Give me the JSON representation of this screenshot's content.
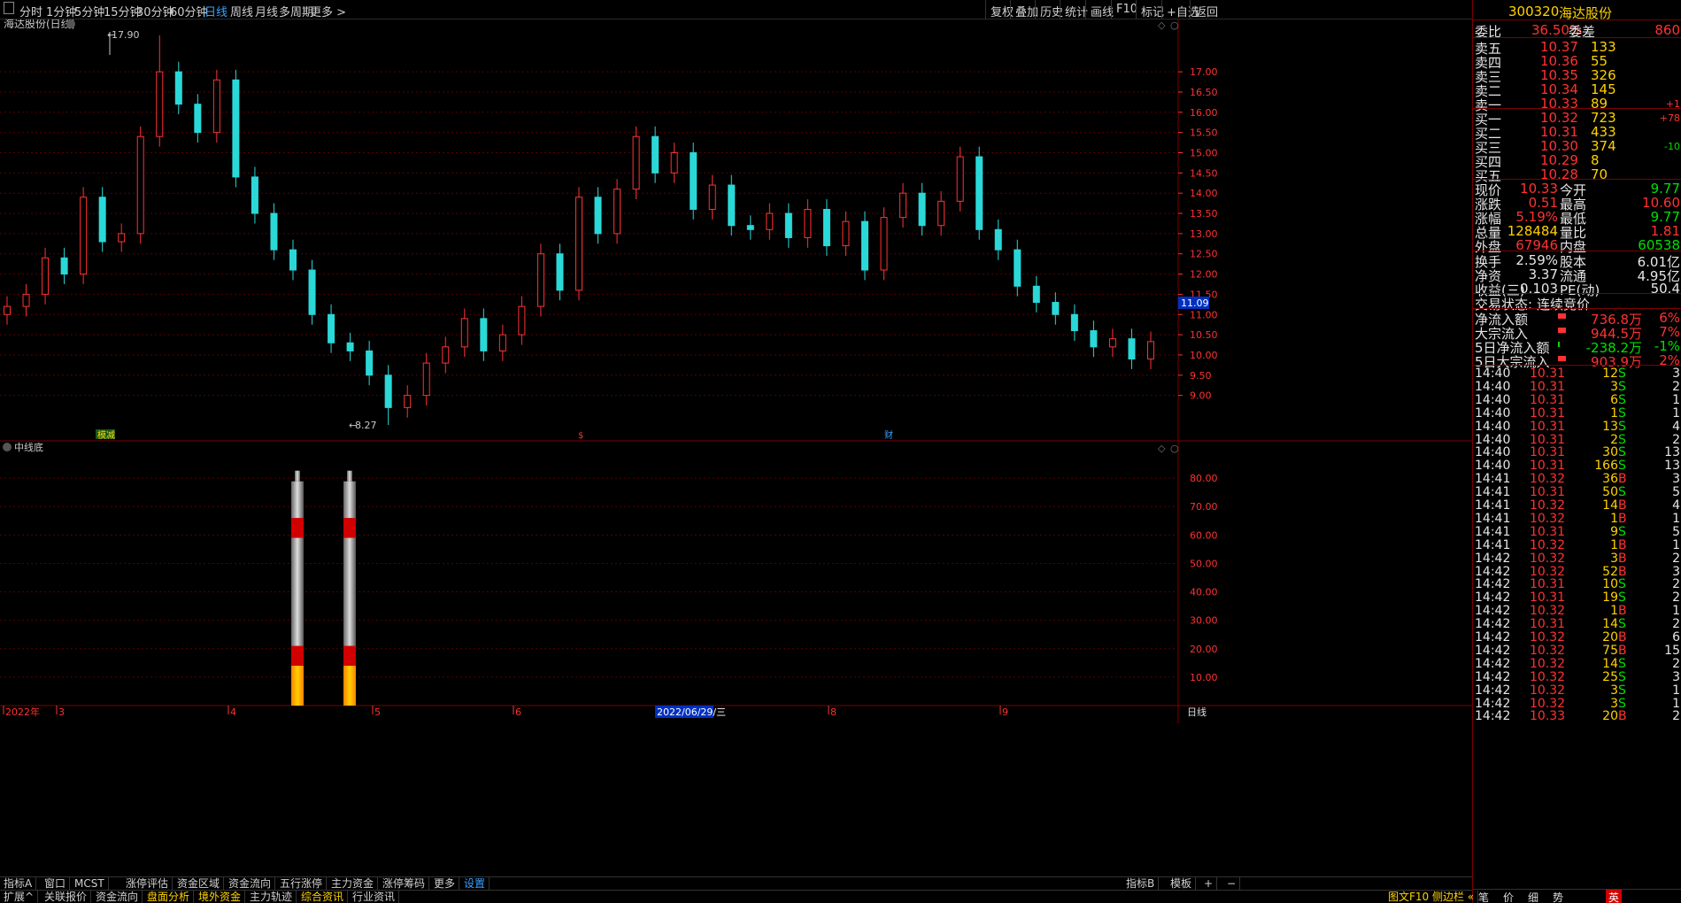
{
  "topbar": {
    "left_tabs": [
      "分时",
      "1分钟",
      "5分钟",
      "15分钟",
      "30分钟",
      "60分钟",
      "日线",
      "周线",
      "月线",
      "多周期",
      "更多 >"
    ],
    "active_tab": "日线",
    "right_buttons": [
      "复权",
      "叠加",
      "历史",
      "统计",
      "画线",
      "F10",
      "标记",
      "+自选",
      "返回"
    ]
  },
  "main_chart": {
    "title": "海达股份(日线)",
    "high_label": "17.90",
    "low_label": "8.27",
    "current_price_tag": "11.09",
    "y_ticks": [
      "17.00",
      "16.50",
      "16.00",
      "15.50",
      "15.00",
      "14.50",
      "14.00",
      "13.50",
      "13.00",
      "12.50",
      "12.00",
      "11.50",
      "11.00",
      "10.50",
      "10.00",
      "9.50",
      "9.00"
    ],
    "markers": [
      "模减",
      "$",
      "财"
    ]
  },
  "indicator": {
    "title": "中线底",
    "y_ticks": [
      "80.00",
      "70.00",
      "60.00",
      "50.00",
      "40.00",
      "30.00",
      "20.00",
      "10.00"
    ]
  },
  "x_axis": {
    "labels": [
      "2022年",
      "3",
      "4",
      "5",
      "6",
      "8",
      "9"
    ],
    "cursor_date": "2022/06/29/三",
    "period_label": "日线"
  },
  "chart_data": {
    "type": "candlestick",
    "title": "海达股份(日线)",
    "ylim": [
      8.27,
      17.9
    ],
    "marked_high": 17.9,
    "marked_low": 8.27,
    "closes": [
      11.2,
      11.5,
      12.4,
      12.0,
      13.9,
      12.8,
      13.0,
      15.4,
      17.0,
      16.2,
      15.5,
      16.8,
      14.4,
      13.5,
      12.6,
      12.1,
      11.0,
      10.3,
      10.1,
      9.5,
      8.7,
      9.0,
      9.8,
      10.2,
      10.9,
      10.1,
      10.5,
      11.2,
      12.5,
      11.6,
      13.9,
      13.0,
      14.1,
      15.4,
      14.5,
      15.0,
      13.6,
      14.2,
      13.2,
      13.1,
      13.5,
      12.9,
      13.6,
      12.7,
      13.3,
      12.1,
      13.4,
      14.0,
      13.2,
      13.8,
      14.9,
      13.1,
      12.6,
      11.7,
      11.3,
      11.0,
      10.6,
      10.2,
      10.4,
      9.9,
      10.33
    ],
    "indicator_series": {
      "name": "中线底",
      "bars": [
        {
          "x_position": "early 5月",
          "value": 82
        },
        {
          "x_position": "early 5月",
          "value": 82
        }
      ]
    }
  },
  "right_panel": {
    "code": "300320",
    "name": "海达股份",
    "wei_bi_label": "委比",
    "wei_bi": "36.50%",
    "wei_cha_label": "委差",
    "wei_cha": "860",
    "asks": [
      {
        "label": "卖五",
        "price": "10.37",
        "vol": "133",
        "chg": ""
      },
      {
        "label": "卖四",
        "price": "10.36",
        "vol": "55",
        "chg": ""
      },
      {
        "label": "卖三",
        "price": "10.35",
        "vol": "326",
        "chg": ""
      },
      {
        "label": "卖二",
        "price": "10.34",
        "vol": "145",
        "chg": ""
      },
      {
        "label": "卖一",
        "price": "10.33",
        "vol": "89",
        "chg": "+1"
      }
    ],
    "bids": [
      {
        "label": "买一",
        "price": "10.32",
        "vol": "723",
        "chg": "+78"
      },
      {
        "label": "买二",
        "price": "10.31",
        "vol": "433",
        "chg": ""
      },
      {
        "label": "买三",
        "price": "10.30",
        "vol": "374",
        "chg": "-10"
      },
      {
        "label": "买四",
        "price": "10.29",
        "vol": "8",
        "chg": ""
      },
      {
        "label": "买五",
        "price": "10.28",
        "vol": "70",
        "chg": ""
      }
    ],
    "quote": [
      {
        "l1": "现价",
        "v1": "10.33",
        "l2": "今开",
        "v2": "9.77",
        "c1": "red",
        "c2": "green"
      },
      {
        "l1": "涨跌",
        "v1": "0.51",
        "l2": "最高",
        "v2": "10.60",
        "c1": "red",
        "c2": "red"
      },
      {
        "l1": "涨幅",
        "v1": "5.19%",
        "l2": "最低",
        "v2": "9.77",
        "c1": "red",
        "c2": "green"
      },
      {
        "l1": "总量",
        "v1": "128484",
        "l2": "量比",
        "v2": "1.81",
        "c1": "yellow",
        "c2": "red"
      },
      {
        "l1": "外盘",
        "v1": "67946",
        "l2": "内盘",
        "v2": "60538",
        "c1": "red",
        "c2": "green"
      }
    ],
    "finance": [
      {
        "l1": "换手",
        "v1": "2.59%",
        "l2": "股本",
        "v2": "6.01亿"
      },
      {
        "l1": "净资",
        "v1": "3.37",
        "l2": "流通",
        "v2": "4.95亿"
      },
      {
        "l1": "收益(三)",
        "v1": "0.103",
        "l2": "PE(动)",
        "v2": "50.4"
      }
    ],
    "trade_status_label": "交易状态:",
    "trade_status": "连续竞价",
    "flows": [
      {
        "label": "净流入额",
        "value": "736.8万",
        "pct": "6%",
        "color": "red"
      },
      {
        "label": "大宗流入",
        "value": "944.5万",
        "pct": "7%",
        "color": "red"
      },
      {
        "label": "5日净流入额",
        "value": "-238.2万",
        "pct": "-1%",
        "color": "green"
      },
      {
        "label": "5日大宗流入",
        "value": "903.9万",
        "pct": "2%",
        "color": "red"
      }
    ],
    "ticks": [
      {
        "t": "14:40",
        "p": "10.31",
        "v": "12",
        "s": "S",
        "n": "3"
      },
      {
        "t": "14:40",
        "p": "10.31",
        "v": "3",
        "s": "S",
        "n": "2"
      },
      {
        "t": "14:40",
        "p": "10.31",
        "v": "6",
        "s": "S",
        "n": "1"
      },
      {
        "t": "14:40",
        "p": "10.31",
        "v": "1",
        "s": "S",
        "n": "1"
      },
      {
        "t": "14:40",
        "p": "10.31",
        "v": "13",
        "s": "S",
        "n": "4"
      },
      {
        "t": "14:40",
        "p": "10.31",
        "v": "2",
        "s": "S",
        "n": "2"
      },
      {
        "t": "14:40",
        "p": "10.31",
        "v": "30",
        "s": "S",
        "n": "13"
      },
      {
        "t": "14:40",
        "p": "10.31",
        "v": "166",
        "s": "S",
        "n": "13"
      },
      {
        "t": "14:41",
        "p": "10.32",
        "v": "36",
        "s": "B",
        "n": "3"
      },
      {
        "t": "14:41",
        "p": "10.31",
        "v": "50",
        "s": "S",
        "n": "5"
      },
      {
        "t": "14:41",
        "p": "10.32",
        "v": "14",
        "s": "B",
        "n": "4"
      },
      {
        "t": "14:41",
        "p": "10.32",
        "v": "1",
        "s": "B",
        "n": "1"
      },
      {
        "t": "14:41",
        "p": "10.31",
        "v": "9",
        "s": "S",
        "n": "5"
      },
      {
        "t": "14:41",
        "p": "10.32",
        "v": "1",
        "s": "B",
        "n": "1"
      },
      {
        "t": "14:42",
        "p": "10.32",
        "v": "3",
        "s": "B",
        "n": "2"
      },
      {
        "t": "14:42",
        "p": "10.32",
        "v": "52",
        "s": "B",
        "n": "3"
      },
      {
        "t": "14:42",
        "p": "10.31",
        "v": "10",
        "s": "S",
        "n": "2"
      },
      {
        "t": "14:42",
        "p": "10.31",
        "v": "19",
        "s": "S",
        "n": "2"
      },
      {
        "t": "14:42",
        "p": "10.32",
        "v": "1",
        "s": "B",
        "n": "1"
      },
      {
        "t": "14:42",
        "p": "10.31",
        "v": "14",
        "s": "S",
        "n": "2"
      },
      {
        "t": "14:42",
        "p": "10.32",
        "v": "20",
        "s": "B",
        "n": "6"
      },
      {
        "t": "14:42",
        "p": "10.32",
        "v": "75",
        "s": "B",
        "n": "15"
      },
      {
        "t": "14:42",
        "p": "10.32",
        "v": "14",
        "s": "S",
        "n": "2"
      },
      {
        "t": "14:42",
        "p": "10.32",
        "v": "25",
        "s": "S",
        "n": "3"
      },
      {
        "t": "14:42",
        "p": "10.32",
        "v": "3",
        "s": "S",
        "n": "1"
      },
      {
        "t": "14:42",
        "p": "10.32",
        "v": "3",
        "s": "S",
        "n": "1"
      },
      {
        "t": "14:42",
        "p": "10.33",
        "v": "20",
        "s": "B",
        "n": "2"
      }
    ],
    "bottom_tabs": [
      "笔",
      "价",
      "细",
      "势"
    ],
    "ime": "英"
  },
  "bottom_bar1": {
    "tabs": [
      "指标A",
      "窗口",
      "MCST",
      "涨停评估",
      "资金区域",
      "资金流向",
      "五行涨停",
      "主力资金",
      "涨停筹码",
      "更多",
      "设置"
    ],
    "right": [
      "指标B",
      "模板",
      "+",
      "−"
    ]
  },
  "bottom_bar2": {
    "tabs": [
      "扩展^",
      "关联报价",
      "资金流向",
      "盘面分析",
      "境外资金",
      "主力轨迹",
      "综合资讯",
      "行业资讯"
    ],
    "right": "图文F10 侧边栏 «"
  },
  "colors": {
    "up": "#ff3232",
    "down": "#2ad8d8",
    "grid": "#5a0000",
    "accent": "#3aa0ff"
  }
}
